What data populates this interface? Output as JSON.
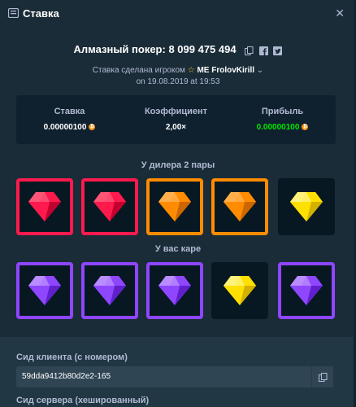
{
  "window": {
    "title": "Ставка"
  },
  "game": {
    "headline": "Алмазный покер: 8 099 475 494",
    "placed_by": "Ставка сделана игроком",
    "rank": "МЕ",
    "player": "FrolovKirill",
    "date_line": "on 19.08.2019 at 19:53"
  },
  "stats": {
    "bet_label": "Ставка",
    "bet_value": "0.00000100",
    "mult_label": "Коэффициент",
    "mult_value": "2,00×",
    "profit_label": "Прибыль",
    "profit_value": "0.00000100"
  },
  "dealer": {
    "label": "У дилера 2 пары",
    "gems": [
      "red",
      "red",
      "orange",
      "orange",
      "yellow"
    ]
  },
  "player_hand": {
    "label": "У вас каре",
    "gems": [
      "purple",
      "purple",
      "purple",
      "yellow",
      "purple"
    ]
  },
  "colors": {
    "red": "#ff1a4d",
    "orange": "#ff8c00",
    "purple": "#8f46ff",
    "yellow": "#ffe000",
    "green": "#00e701"
  },
  "seeds": {
    "client_label": "Сид клиента (с номером)",
    "client_value": "59dda9412b80d2e2-165",
    "server_label": "Сид сервера (хешированный)"
  }
}
